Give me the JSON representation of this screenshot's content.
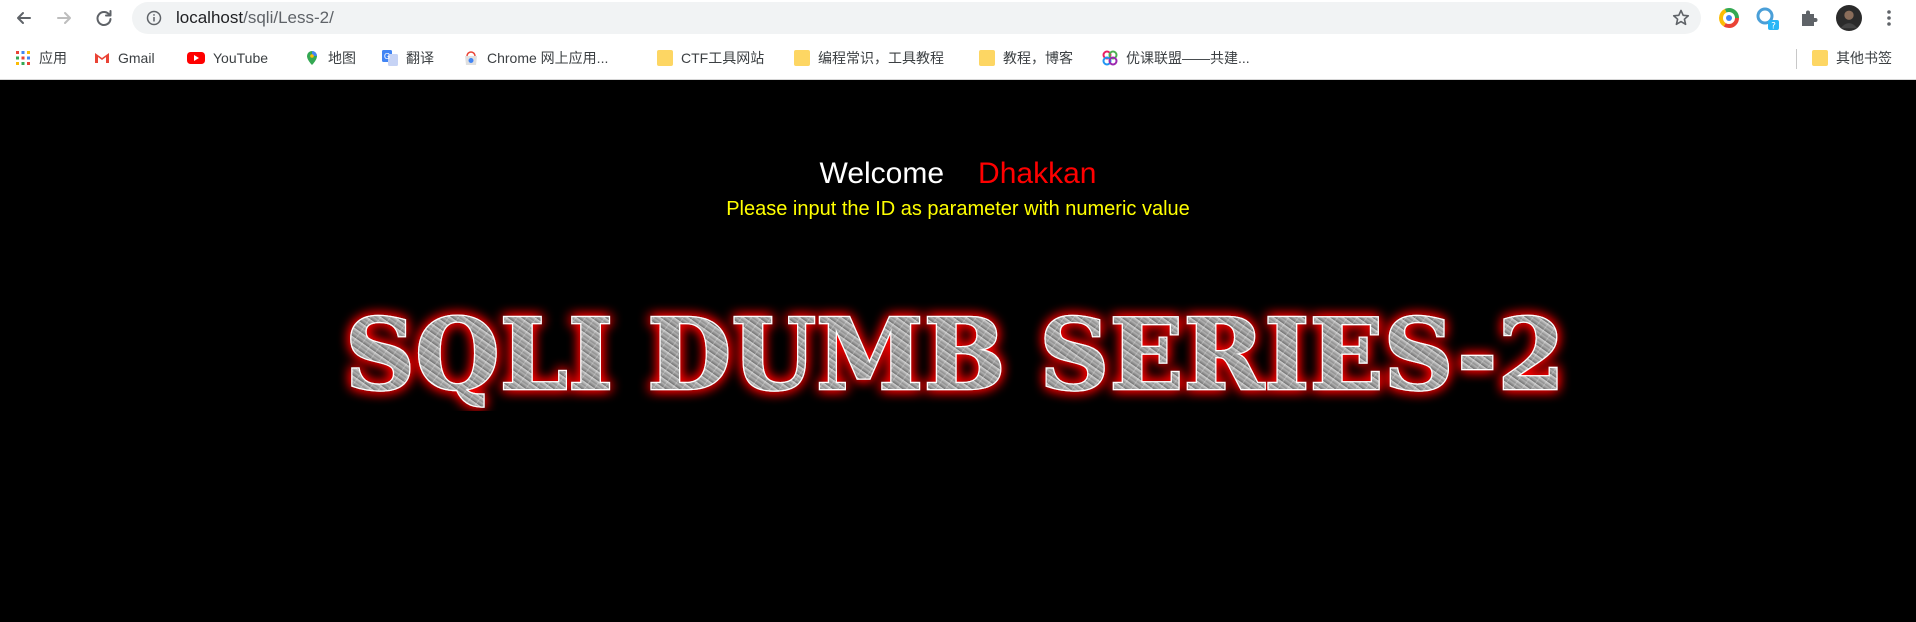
{
  "browser": {
    "url_host": "localhost",
    "url_path": "/sqli/Less-2/",
    "bookmarks": [
      {
        "label": "应用",
        "icon": "apps-grid-icon"
      },
      {
        "label": "Gmail",
        "icon": "gmail-icon"
      },
      {
        "label": "YouTube",
        "icon": "youtube-icon"
      },
      {
        "label": "地图",
        "icon": "maps-icon"
      },
      {
        "label": "翻译",
        "icon": "translate-icon"
      },
      {
        "label": "Chrome 网上应用...",
        "icon": "chrome-webstore-icon"
      },
      {
        "label": "CTF工具网站",
        "icon": "folder-icon"
      },
      {
        "label": "编程常识，工具教程",
        "icon": "folder-icon"
      },
      {
        "label": "教程，博客",
        "icon": "folder-icon"
      },
      {
        "label": "优课联盟——共建...",
        "icon": "uooc-icon"
      }
    ],
    "other_bookmarks": "其他书签",
    "extension_badge": "?"
  },
  "page": {
    "welcome": "Welcome",
    "name": "Dhakkan",
    "instruction": "Please input the ID as parameter with numeric value",
    "banner_text": "SQLI DUMB SERIES-2"
  },
  "colors": {
    "background": "#000000",
    "welcome": "#ffffff",
    "name": "#ff0000",
    "instruction": "#ffff00",
    "banner_glow": "#ff0000"
  }
}
